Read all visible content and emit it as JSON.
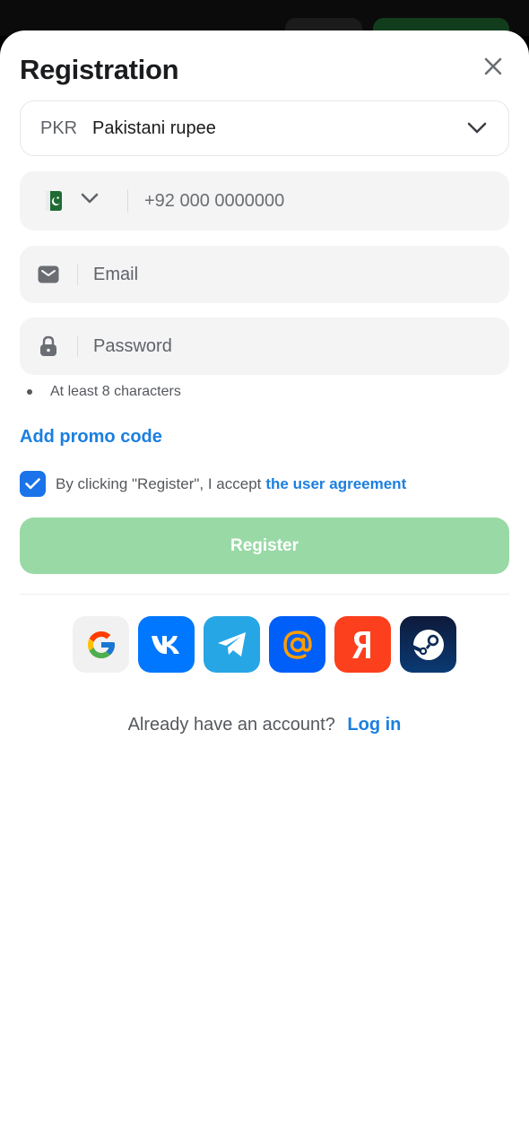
{
  "header": {
    "title": "Registration"
  },
  "currency": {
    "code": "PKR",
    "name": "Pakistani rupee"
  },
  "phone": {
    "prefix": "+92",
    "placeholder": "000 0000000",
    "flag_icon": "pakistan-flag-icon"
  },
  "email": {
    "placeholder": "Email"
  },
  "password": {
    "placeholder": "Password",
    "hint": "At least 8 characters"
  },
  "promo": {
    "label": "Add promo code"
  },
  "agreement": {
    "checked": true,
    "text": "By clicking \"Register\", I accept",
    "link": "the user agreement"
  },
  "register": {
    "label": "Register"
  },
  "social": [
    {
      "name": "google-icon"
    },
    {
      "name": "vk-icon"
    },
    {
      "name": "telegram-icon"
    },
    {
      "name": "mail-ru-icon"
    },
    {
      "name": "yandex-icon"
    },
    {
      "name": "steam-icon"
    }
  ],
  "login": {
    "question": "Already have an account?",
    "link": "Log in"
  },
  "colors": {
    "accent": "#1b7fe0",
    "register_disabled": "#99d9a6",
    "checkbox": "#1a73e8"
  }
}
